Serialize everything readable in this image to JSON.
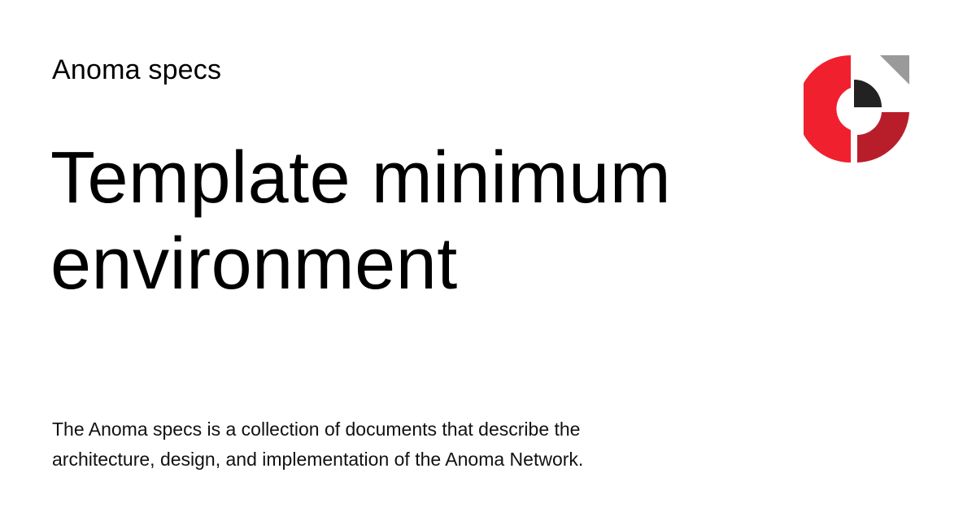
{
  "site": {
    "name": "Anoma specs"
  },
  "page": {
    "title_lines": [
      "Template minimum",
      "environment"
    ],
    "description_lines": [
      "The Anoma specs is a collection of documents that describe the",
      "architecture, design, and implementation of the Anoma Network."
    ]
  },
  "logo": {
    "icon": "anoma-logo-icon",
    "colors": {
      "red": "#F0202E",
      "dark_red": "#B81E2A",
      "black": "#222222",
      "gray": "#9A9A9A"
    }
  }
}
